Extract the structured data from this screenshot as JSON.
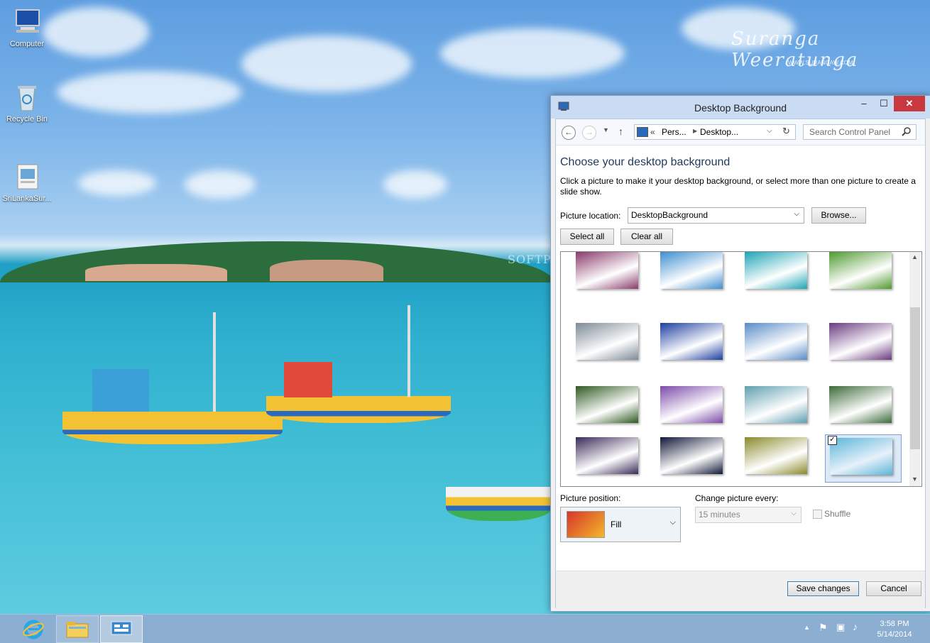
{
  "desktop": {
    "icons": [
      {
        "label": "Computer"
      },
      {
        "label": "Recycle Bin"
      },
      {
        "label": "SriLankaSur..."
      }
    ],
    "watermark": "Suranga Weeratunga",
    "watermark_sub": "WWW.SURANGAW.COM",
    "softpedia": "SOFTPEDIA"
  },
  "window": {
    "title": "Desktop Background",
    "controls": {
      "minimize": "–",
      "maximize": "☐",
      "close": "✕"
    },
    "address": {
      "back": "←",
      "forward": "→",
      "up": "↑",
      "refresh": "↻",
      "crumb_sep": "«",
      "crumb1": "Pers...",
      "crumb2": "Desktop..."
    },
    "search": {
      "placeholder": "Search Control Panel"
    },
    "heading": "Choose your desktop background",
    "description": "Click a picture to make it your desktop background, or select more than one picture to create a slide show.",
    "picture_location": {
      "label": "Picture location:",
      "value": "DesktopBackground"
    },
    "browse_label": "Browse...",
    "select_all_label": "Select all",
    "clear_all_label": "Clear all",
    "thumbnails": [
      {
        "name": "sunset-fishermen",
        "color": "#8a3a6a",
        "selected": false
      },
      {
        "name": "beach-house",
        "color": "#3f8fd0",
        "selected": false
      },
      {
        "name": "turquoise-bay",
        "color": "#1fa5b5",
        "selected": false
      },
      {
        "name": "green-hills",
        "color": "#4f9a2e",
        "selected": false
      },
      {
        "name": "stone-steps",
        "color": "#7d8a96",
        "selected": false
      },
      {
        "name": "city-lights-blue",
        "color": "#1c3ea0",
        "selected": false
      },
      {
        "name": "statues",
        "color": "#5a8cc8",
        "selected": false
      },
      {
        "name": "purple-sunset-rock",
        "color": "#6a3a80",
        "selected": false
      },
      {
        "name": "waterfall-forest",
        "color": "#2f5a22",
        "selected": false
      },
      {
        "name": "purple-twilight",
        "color": "#7c4aa8",
        "selected": false
      },
      {
        "name": "palm-lake",
        "color": "#5f9fb0",
        "selected": false
      },
      {
        "name": "jungle-waterfall",
        "color": "#3d6a3a",
        "selected": false
      },
      {
        "name": "night-lake",
        "color": "#3a2a58",
        "selected": false
      },
      {
        "name": "night-city",
        "color": "#101838",
        "selected": false
      },
      {
        "name": "bee-eater-bird",
        "color": "#8a8a2c",
        "selected": false
      },
      {
        "name": "boats-lagoon",
        "color": "#5ab6d8",
        "selected": true
      }
    ],
    "picture_position": {
      "label": "Picture position:",
      "value": "Fill"
    },
    "change_every": {
      "label": "Change picture every:",
      "value": "15 minutes"
    },
    "shuffle_label": "Shuffle",
    "save_label": "Save changes",
    "cancel_label": "Cancel"
  },
  "taskbar": {
    "time": "3:58 PM",
    "date": "5/14/2014"
  }
}
